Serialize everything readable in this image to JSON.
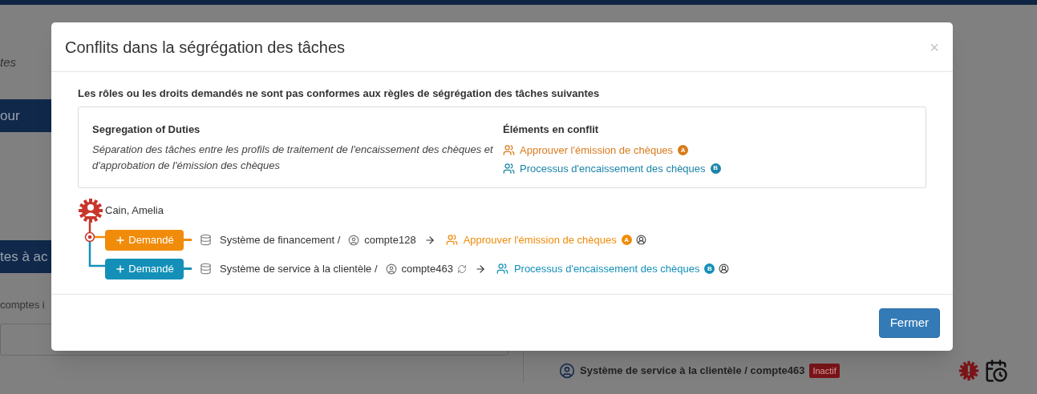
{
  "background": {
    "left_fragments": [
      {
        "kind": "italic",
        "text": "tes"
      },
      {
        "kind": "banner",
        "text": "our"
      },
      {
        "kind": "banner",
        "text": "tes à ac"
      },
      {
        "kind": "plain",
        "text": "comptes i"
      }
    ],
    "account_row": {
      "name": "Système de service à la clientèle / compte463",
      "status": "Inactif"
    }
  },
  "dialog": {
    "title": "Conflits dans la ségrégation des tâches",
    "close": "×",
    "intro": "Les rôles ou les droits demandés ne sont pas conformes aux règles de ségrégation des tâches suivantes",
    "rule": {
      "heading": "Segregation of Duties",
      "description": "Séparation des tâches entre les profils de traitement de l'encaissement des chèques et d'approbation de l'émission des chèques"
    },
    "conflicts": {
      "heading": "Éléments en conflit",
      "items": [
        {
          "label": "Approuver l'émission de chèques",
          "marker": "A",
          "color": "#d97a1c"
        },
        {
          "label": "Processus d'encaissement des chèques",
          "marker": "B",
          "color": "#1b84a8"
        }
      ]
    },
    "user": "Cain, Amelia",
    "requests": [
      {
        "action": "Demandé",
        "system": "Système de financement /",
        "account": "compte128",
        "sync": false,
        "target": "Approuver l'émission de chèques",
        "marker": "A",
        "color": "#f08c0a"
      },
      {
        "action": "Demandé",
        "system": "Système de service à la clientèle /",
        "account": "compte463",
        "sync": true,
        "target": "Processus d'encaissement des chèques",
        "marker": "B",
        "color": "#1490b8"
      }
    ],
    "buttons": [
      "Fermer"
    ]
  }
}
